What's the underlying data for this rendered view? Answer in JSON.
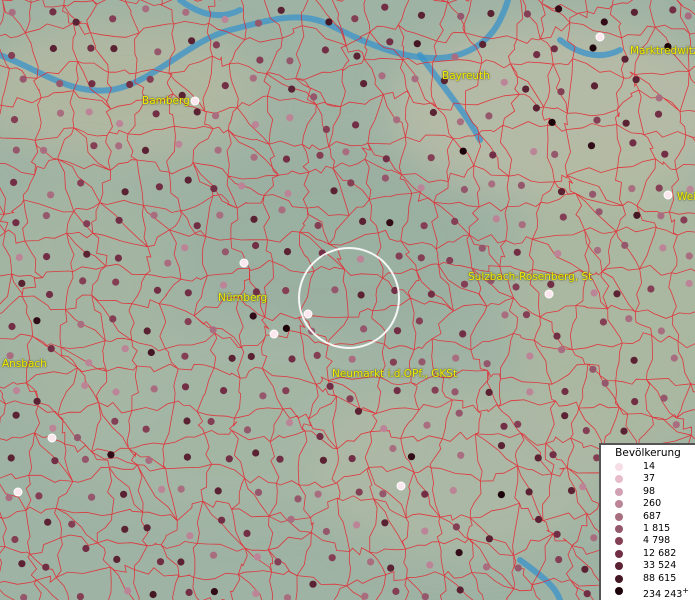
{
  "map": {
    "cities": [
      {
        "name": "Bamberg",
        "marker": true
      },
      {
        "name": "Bayreuth",
        "marker": false
      },
      {
        "name": "Marktredwitz",
        "marker": true
      },
      {
        "name": "Weiden",
        "marker": true
      },
      {
        "name": "Nürnberg",
        "marker": true
      },
      {
        "name": "Sulzbach-Rosenberg, St",
        "marker": true
      },
      {
        "name": "Ansbach",
        "marker": false
      },
      {
        "name": "Neumarkt i.d.OPf., GKSt",
        "marker": true
      }
    ],
    "city_label_color": "#f4f000",
    "boundary_color": "#e8202a",
    "water_color": "#3a93c9",
    "marker_palette": [
      "#f7dde6",
      "#e6bccb",
      "#d1a0b2",
      "#bb8597",
      "#a96d80",
      "#95576b",
      "#843f55",
      "#712e44",
      "#5a2232",
      "#451623",
      "#320c17",
      "#1d040b"
    ]
  },
  "legend": {
    "title": "Bevölkerung",
    "items": [
      "14",
      "37",
      "98",
      "260",
      "687",
      "1 815",
      "4 798",
      "12 682",
      "33 524",
      "88 615",
      "234 243"
    ],
    "last_suffix": "+",
    "colors": [
      "#f7dde6",
      "#e6bccb",
      "#d1a0b2",
      "#bb8597",
      "#a96d80",
      "#95576b",
      "#843f55",
      "#712e44",
      "#5a2232",
      "#451623",
      "#1d040b"
    ]
  }
}
